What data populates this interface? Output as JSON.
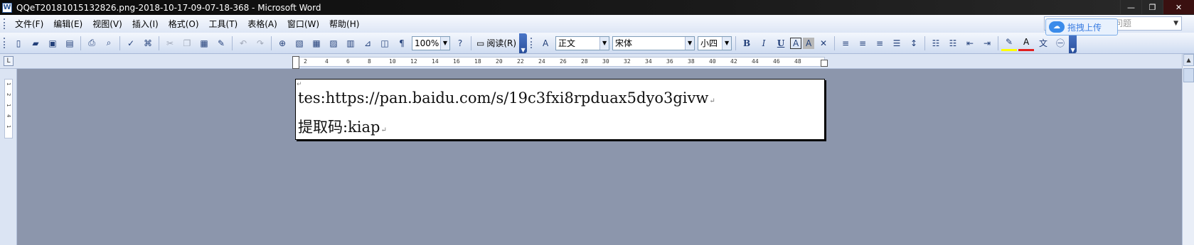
{
  "window": {
    "title": "QQeT20181015132826.png-2018-10-17-09-07-18-368 - Microsoft Word",
    "app_icon": "W"
  },
  "window_controls": {
    "minimize": "—",
    "restore": "❐",
    "close": "✕"
  },
  "menu": {
    "items": [
      "文件(F)",
      "编辑(E)",
      "视图(V)",
      "插入(I)",
      "格式(O)",
      "工具(T)",
      "表格(A)",
      "窗口(W)",
      "帮助(H)"
    ],
    "help_placeholder": "问题"
  },
  "baidu": {
    "label": "拖拽上传"
  },
  "toolbar": {
    "zoom": "100%",
    "read_label": "阅读(R)",
    "style": "正文",
    "font": "宋体",
    "size": "小四",
    "bold": "B",
    "italic": "I",
    "underline": "U",
    "char_border": "A",
    "char_shading": "A",
    "phonetic": "文"
  },
  "ruler": {
    "ticks": [
      "2",
      "4",
      "6",
      "8",
      "10",
      "12",
      "14",
      "16",
      "18",
      "20",
      "22",
      "24",
      "26",
      "28",
      "30",
      "32",
      "34",
      "36",
      "38",
      "40",
      "42",
      "44",
      "46",
      "48"
    ],
    "vticks": [
      "1",
      "2",
      "1",
      "4",
      "1"
    ]
  },
  "document": {
    "lines": [
      "tes:https://pan.baidu.com/s/19c3fxi8rpduax5dyo3givw",
      "提取码:kiap"
    ],
    "para_mark": "↵"
  }
}
